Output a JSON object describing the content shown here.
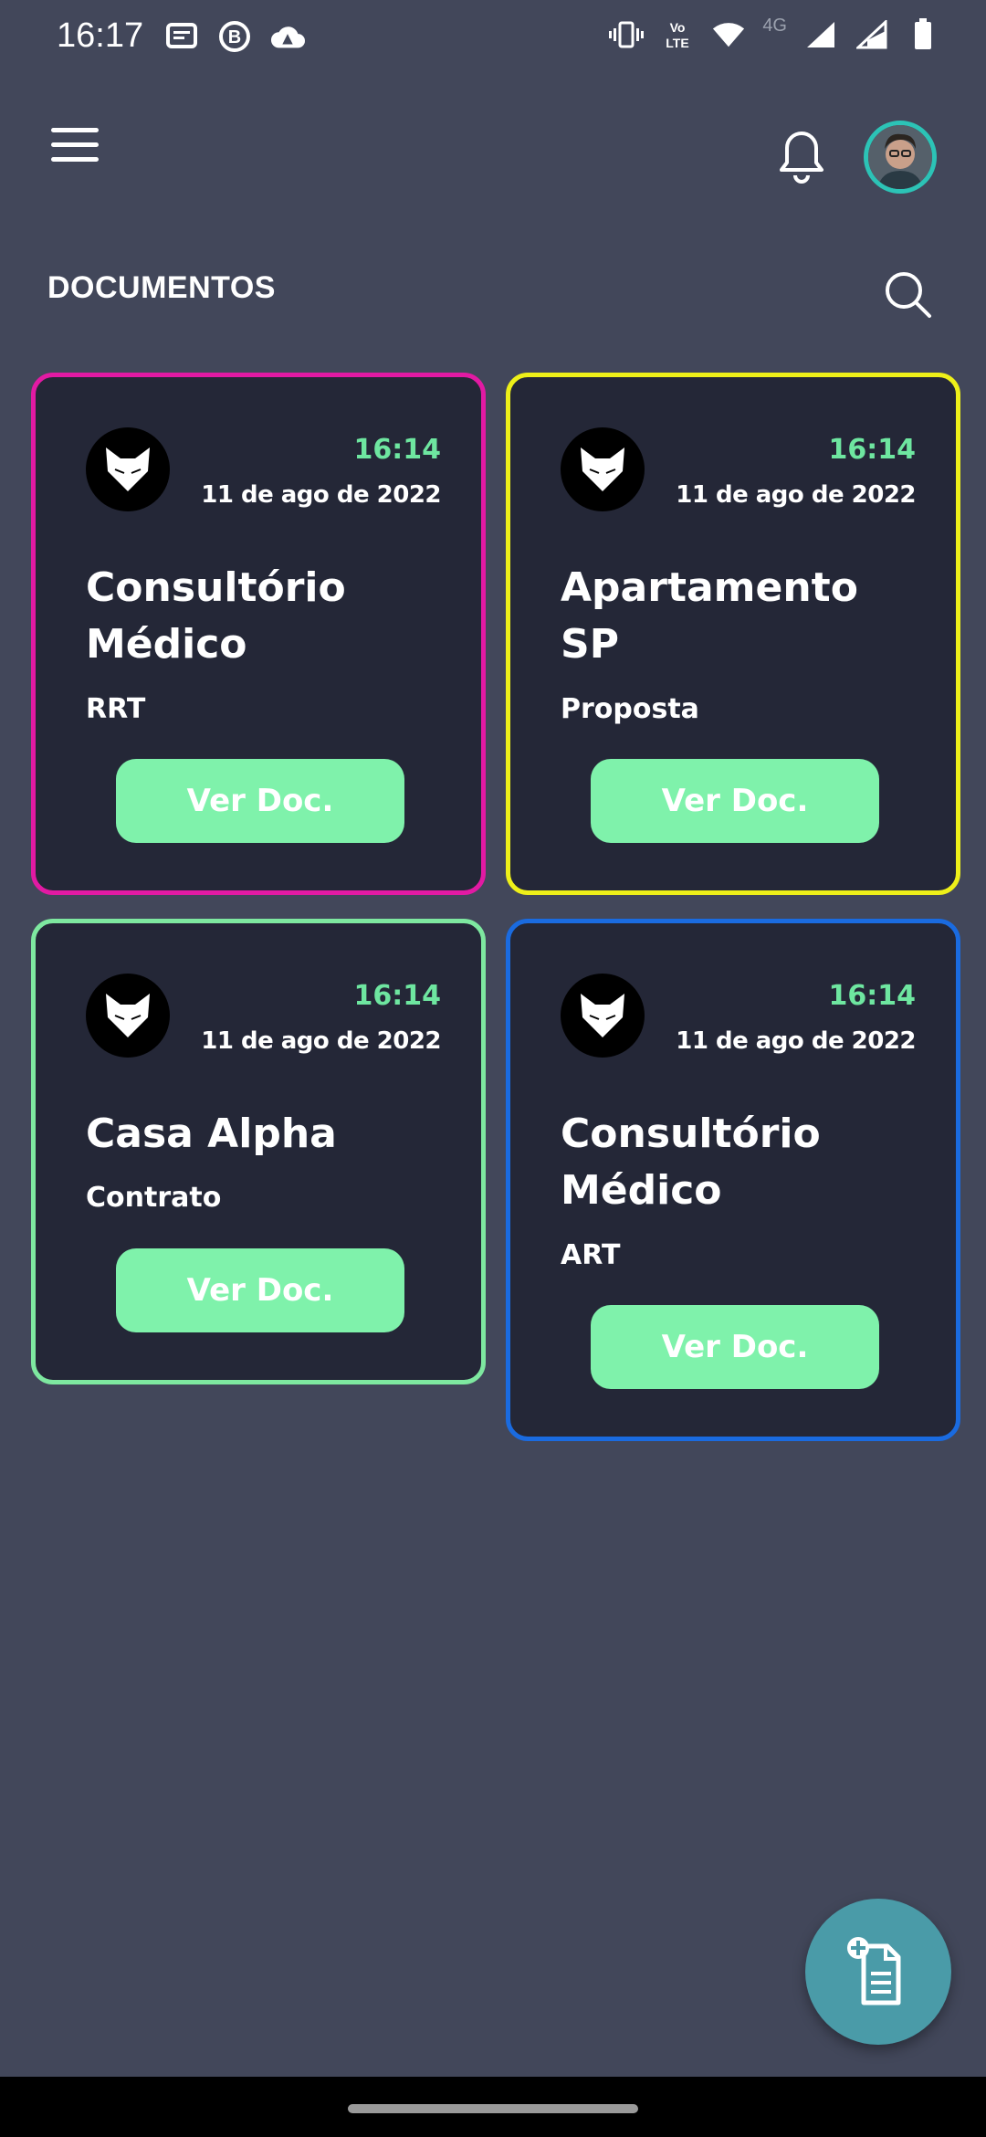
{
  "status_bar": {
    "time": "16:17",
    "left_icons": [
      "message-icon",
      "b-badge-icon",
      "cloud-warning-icon"
    ],
    "right_icons": [
      "vibrate-icon",
      "volte-icon",
      "wifi-icon",
      "signal-icon",
      "signal-icon",
      "battery-icon"
    ],
    "network_label": "4G",
    "volte_label": "Vo LTE"
  },
  "header": {
    "title": "DOCUMENTOS"
  },
  "cards": [
    {
      "border_color": "#e21aa3",
      "time": "16:14",
      "date": "11 de ago de 2022",
      "title": "Consultório Médico",
      "subtitle": "RRT",
      "button_label": "Ver Doc."
    },
    {
      "border_color": "#eef019",
      "time": "16:14",
      "date": "11 de ago de 2022",
      "title": "Apartamento SP",
      "subtitle": "Proposta",
      "button_label": "Ver Doc."
    },
    {
      "border_color": "#7ee8a0",
      "time": "16:14",
      "date": "11 de ago de 2022",
      "title": "Casa Alpha",
      "subtitle": "Contrato",
      "button_label": "Ver Doc."
    },
    {
      "border_color": "#1a6be0",
      "time": "16:14",
      "date": "11 de ago de 2022",
      "title": "Consultório Médico",
      "subtitle": "ART",
      "button_label": "Ver Doc."
    }
  ],
  "colors": {
    "background": "#42475a",
    "card_background": "#242737",
    "accent_green": "#7ff2ab",
    "time_green": "#6ee6a0",
    "fab": "#4a9ba8",
    "avatar_ring": "#2cc3b6"
  },
  "fab": {
    "icon": "add-document-icon"
  }
}
